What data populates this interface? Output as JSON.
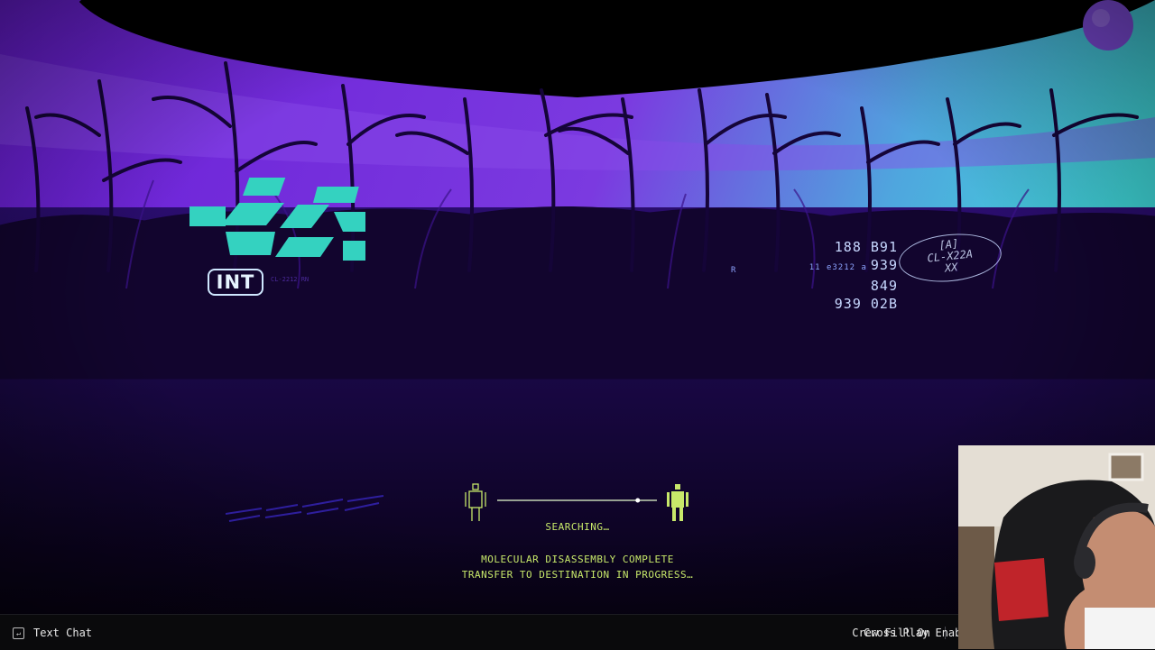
{
  "hud": {
    "badge": "INT",
    "badge_code": "CL-2212 RN",
    "readout": {
      "marker": "R",
      "row1": "188  B91",
      "row2_prefix": "11 e3212 a",
      "row2": "939  849",
      "row3": "939  02B"
    },
    "stamp_top": "[A]",
    "stamp_main": "CL-X22A",
    "stamp_bottom": "XX"
  },
  "transfer": {
    "status": "SEARCHING…",
    "message_line1": "MOLECULAR DISASSEMBLY COMPLETE",
    "message_line2": "TRANSFER TO DESTINATION IN PROGRESS…",
    "progress": 0.88
  },
  "bottom_bar": {
    "text_chat_label": "Text Chat",
    "crew_fill_label": "Crew Fill On",
    "cross_play_label": "Cross Play Enabled"
  },
  "colors": {
    "sky_top": "#6a1ed6",
    "sky_bottom": "#3fd6d8",
    "accent_teal": "#34d2c0",
    "hud_green": "#c7e86a",
    "bar_bg": "#0a0a0c"
  },
  "icons": {
    "chat": "keyboard-icon",
    "figure_left": "outline-figure-icon",
    "figure_right": "solid-figure-icon"
  }
}
